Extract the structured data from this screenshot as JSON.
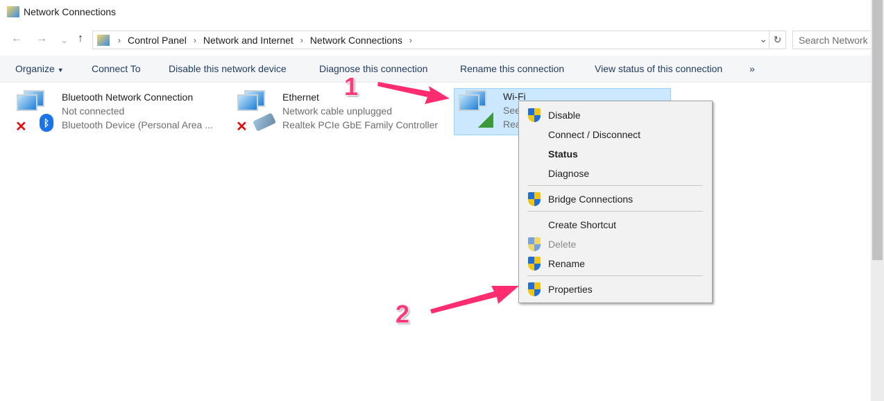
{
  "window": {
    "title": "Network Connections"
  },
  "address": {
    "crumbs": [
      "Control Panel",
      "Network and Internet",
      "Network Connections"
    ],
    "search_placeholder": "Search Network"
  },
  "toolbar": {
    "organize": "Organize",
    "connect_to": "Connect To",
    "disable": "Disable this network device",
    "diagnose": "Diagnose this connection",
    "rename": "Rename this connection",
    "view_status": "View status of this connection",
    "more": "»"
  },
  "connections": [
    {
      "name": "Bluetooth Network Connection",
      "status": "Not connected",
      "device": "Bluetooth Device (Personal Area ..."
    },
    {
      "name": "Ethernet",
      "status": "Network cable unplugged",
      "device": "Realtek PCIe GbE Family Controller"
    },
    {
      "name": "Wi-Fi",
      "status": "See",
      "device": "Rea"
    }
  ],
  "context_menu": {
    "items": [
      "Disable",
      "Connect / Disconnect",
      "Status",
      "Diagnose",
      "Bridge Connections",
      "Create Shortcut",
      "Delete",
      "Rename",
      "Properties"
    ]
  },
  "annotations": {
    "step1": "1",
    "step2": "2",
    "arrow_color": "#ff2d6f"
  }
}
